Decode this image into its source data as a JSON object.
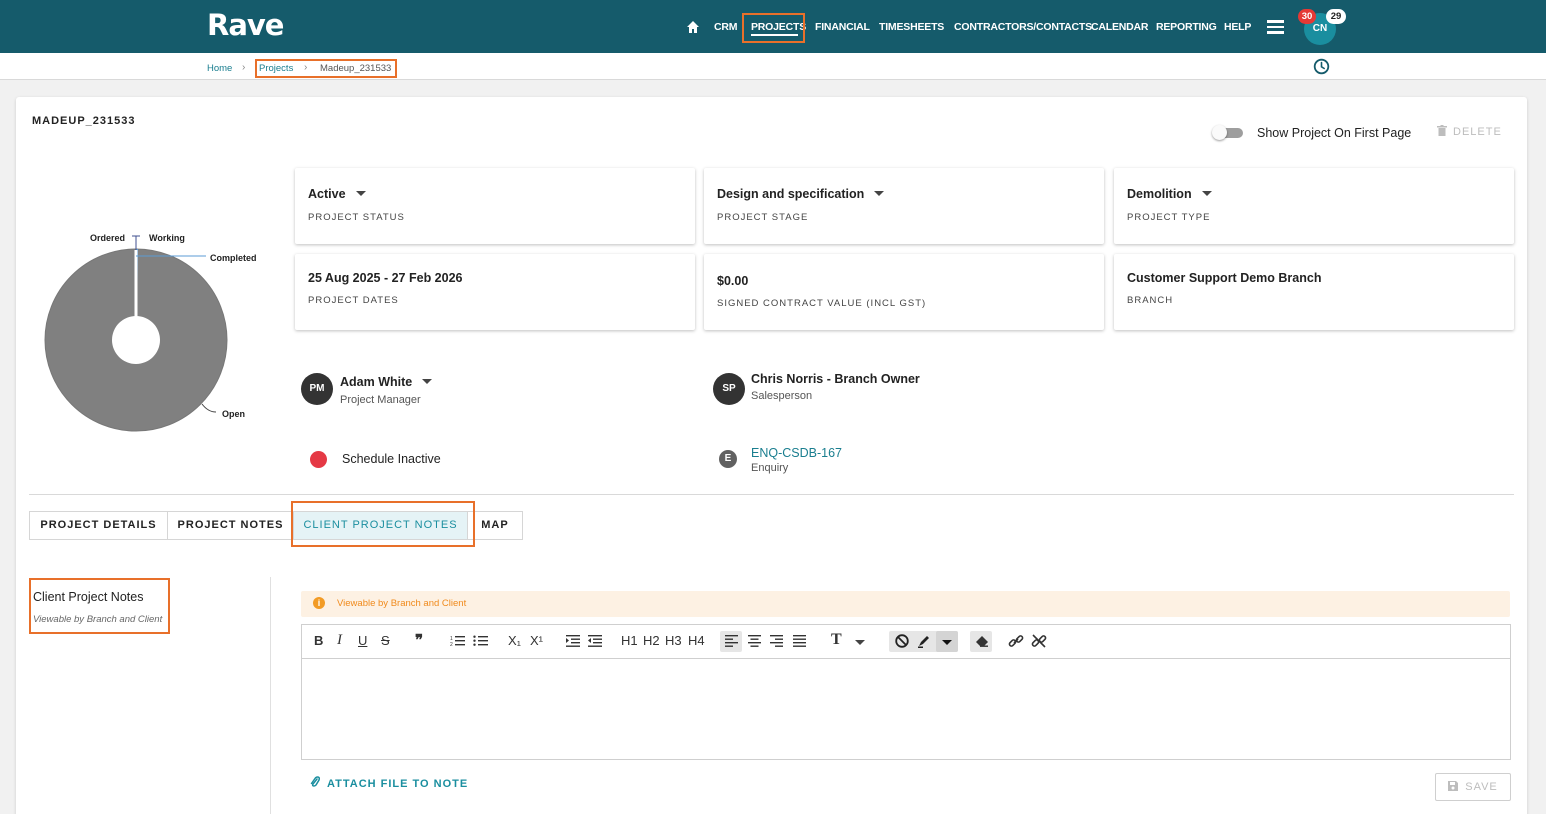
{
  "app": {
    "logo": "Rave"
  },
  "nav": {
    "items": [
      "CRM",
      "PROJECTS",
      "FINANCIAL",
      "TIMESHEETS",
      "CONTRACTORS/CONTACTS",
      "CALENDAR",
      "REPORTING",
      "HELP"
    ],
    "active": "PROJECTS",
    "avatar_initials": "CN",
    "notification_count": "30",
    "message_count": "29"
  },
  "breadcrumb": {
    "home": "Home",
    "projects": "Projects",
    "current": "Madeup_231533"
  },
  "project": {
    "title": "MADEUP_231533",
    "show_on_first_page_label": "Show Project On First Page",
    "show_on_first_page": false,
    "delete_label": "DELETE"
  },
  "donut_chart": {
    "labels": {
      "ordered": "Ordered",
      "working": "Working",
      "completed": "Completed",
      "open": "Open"
    },
    "colors": {
      "open": "#808080",
      "completed": "#5b9bd5",
      "working": "#3f4f8f"
    }
  },
  "tiles": {
    "status": {
      "value": "Active",
      "label": "PROJECT STATUS"
    },
    "stage": {
      "value": "Design and specification",
      "label": "PROJECT STAGE"
    },
    "type": {
      "value": "Demolition",
      "label": "PROJECT TYPE"
    },
    "dates": {
      "value": "25 Aug 2025  - 27 Feb 2026",
      "label": "PROJECT DATES"
    },
    "contract": {
      "value": "$0.00",
      "label": "SIGNED CONTRACT VALUE (INCL GST)"
    },
    "branch": {
      "value": "Customer Support Demo Branch",
      "label": "BRANCH"
    }
  },
  "people": {
    "pm": {
      "initials": "PM",
      "name": "Adam White",
      "role": "Project Manager"
    },
    "sp": {
      "initials": "SP",
      "name": "Chris Norris - Branch Owner",
      "role": "Salesperson"
    }
  },
  "schedule": {
    "text": "Schedule Inactive",
    "color": "#e53945"
  },
  "enquiry": {
    "icon_letter": "E",
    "link": "ENQ-CSDB-167",
    "role": "Enquiry"
  },
  "tabs": {
    "items": [
      "PROJECT DETAILS",
      "PROJECT NOTES",
      "CLIENT PROJECT NOTES",
      "MAP"
    ],
    "active": "CLIENT PROJECT NOTES"
  },
  "notes_section": {
    "title": "Client Project Notes",
    "subtitle": "Viewable by Branch and Client",
    "notice": "Viewable by Branch and Client",
    "attach_label": "ATTACH FILE TO NOTE",
    "save_label": "SAVE"
  },
  "editor_toolbar": {
    "headings": [
      "H1",
      "H2",
      "H3",
      "H4"
    ],
    "text_format_glyph": "T",
    "bold": "B",
    "italic": "I",
    "underline": "U",
    "strike": "S",
    "subscript": "X₁",
    "superscript": "X¹"
  },
  "theme": {
    "primary": "#155b6b",
    "accent": "#1a8e9f",
    "highlight": "#e8702a"
  }
}
